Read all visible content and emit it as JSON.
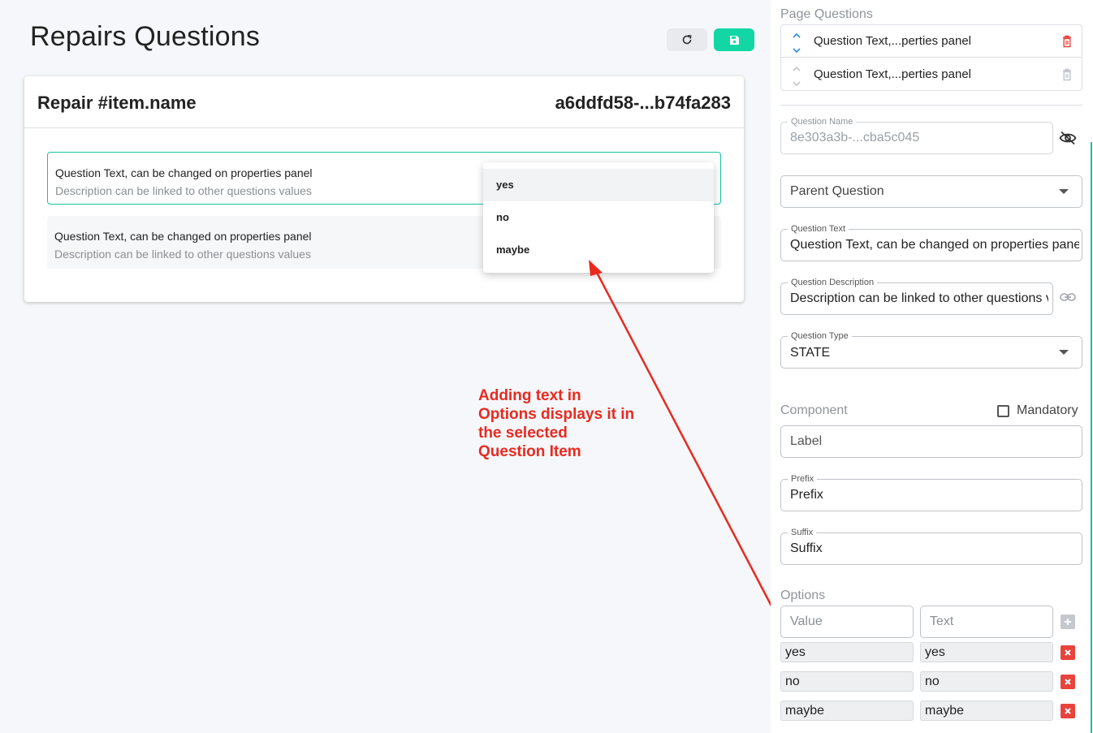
{
  "page": {
    "title": "Repairs Questions"
  },
  "card": {
    "title": "Repair #item.name",
    "id": "a6ddfd58-...b74fa283",
    "questions": [
      {
        "text": "Question Text, can be changed on properties panel",
        "description": "Description can be linked to other questions values"
      },
      {
        "text": "Question Text, can be changed on properties panel",
        "description": "Description can be linked to other questions values"
      }
    ]
  },
  "dropdown": {
    "options": [
      "yes",
      "no",
      "maybe"
    ]
  },
  "annotation": {
    "lines": [
      "Adding text in",
      "Options displays it in",
      "the selected",
      "Question Item"
    ]
  },
  "panel": {
    "page_questions_label": "Page Questions",
    "page_questions": [
      {
        "text": "Question Text,...perties panel"
      },
      {
        "text": "Question Text,...perties panel"
      }
    ],
    "question_name": {
      "label": "Question Name",
      "value": "8e303a3b-...cba5c045"
    },
    "parent_question": {
      "placeholder": "Parent Question"
    },
    "question_text": {
      "label": "Question Text",
      "value": "Question Text, can be changed on properties panel"
    },
    "question_description": {
      "label": "Question Description",
      "value": "Description can be linked to other questions values"
    },
    "question_type": {
      "label": "Question Type",
      "value": "STATE"
    },
    "component_label": "Component",
    "mandatory_label": "Mandatory",
    "label_field": {
      "placeholder": "Label"
    },
    "prefix": {
      "label": "Prefix",
      "value": "Prefix"
    },
    "suffix": {
      "label": "Suffix",
      "value": "Suffix"
    },
    "options_label": "Options",
    "option_inputs": {
      "value_placeholder": "Value",
      "text_placeholder": "Text"
    },
    "options": [
      {
        "value": "yes",
        "text": "yes"
      },
      {
        "value": "no",
        "text": "no"
      },
      {
        "value": "maybe",
        "text": "maybe"
      }
    ]
  },
  "colors": {
    "accent": "#13d6a5",
    "selected_border": "#13c4a0",
    "danger": "#e8433c",
    "annotation": "#e82a20"
  }
}
